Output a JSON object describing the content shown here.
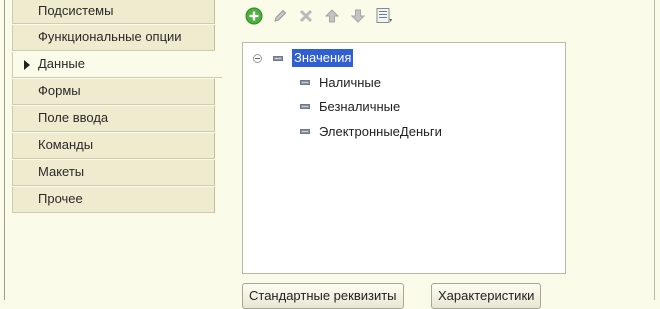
{
  "sidebar": {
    "items": [
      {
        "label": "Подсистемы",
        "active": false
      },
      {
        "label": "Функциональные опции",
        "active": false
      },
      {
        "label": "Данные",
        "active": true
      },
      {
        "label": "Формы",
        "active": false
      },
      {
        "label": "Поле ввода",
        "active": false
      },
      {
        "label": "Команды",
        "active": false
      },
      {
        "label": "Макеты",
        "active": false
      },
      {
        "label": "Прочее",
        "active": false
      }
    ]
  },
  "toolbar": {
    "icons": [
      "add-icon",
      "edit-pencil-icon",
      "delete-icon",
      "move-up-icon",
      "move-down-icon",
      "list-icon"
    ]
  },
  "tree": {
    "root": "Значения",
    "children": [
      "Наличные",
      "Безналичные",
      "ЭлектронныеДеньги"
    ]
  },
  "buttons": {
    "standard_attributes": "Стандартные реквизиты",
    "characteristics": "Характеристики"
  },
  "colors": {
    "background": "#fbfbe9",
    "tab_background": "#efebcf",
    "selection": "#2f5fd3",
    "add_icon_green": "#4caf3e"
  }
}
